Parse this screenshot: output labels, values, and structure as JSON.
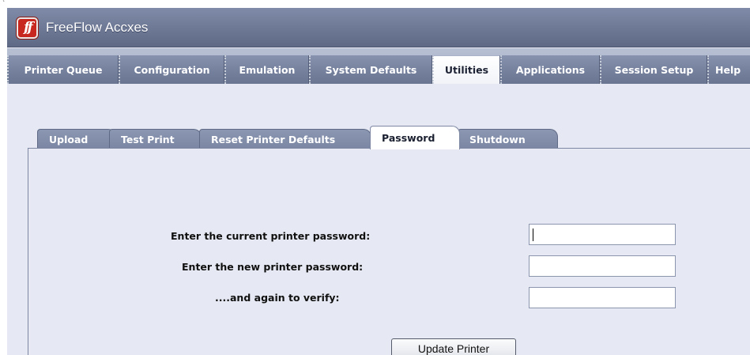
{
  "app": {
    "title": "FreeFlow Accxes",
    "logo_text": "ff",
    "colors": {
      "titlebar": "#6f7a97",
      "menu_tab": "#7a86a3",
      "active_tab": "#ffffff",
      "logo": "#c8271f",
      "content_bg": "#e6e9f3"
    }
  },
  "main_nav": {
    "tabs": [
      {
        "label": "Printer Queue",
        "active": false
      },
      {
        "label": "Configuration",
        "active": false
      },
      {
        "label": "Emulation",
        "active": false
      },
      {
        "label": "System Defaults",
        "active": false
      },
      {
        "label": "Utilities",
        "active": true
      },
      {
        "label": "Applications",
        "active": false
      },
      {
        "label": "Session Setup",
        "active": false
      },
      {
        "label": "Help",
        "active": false
      }
    ]
  },
  "sub_nav": {
    "tabs": [
      {
        "label": "Upload",
        "active": false
      },
      {
        "label": "Test Print",
        "active": false
      },
      {
        "label": "Reset Printer Defaults",
        "active": false
      },
      {
        "label": "Password",
        "active": true
      },
      {
        "label": "Shutdown",
        "active": false
      }
    ]
  },
  "password_form": {
    "current_label": "Enter the current printer password:",
    "current_value": "",
    "new_label": "Enter the new printer password:",
    "new_value": "",
    "verify_label": "....and again to verify:",
    "verify_value": "",
    "submit_label": "Update Printer"
  }
}
